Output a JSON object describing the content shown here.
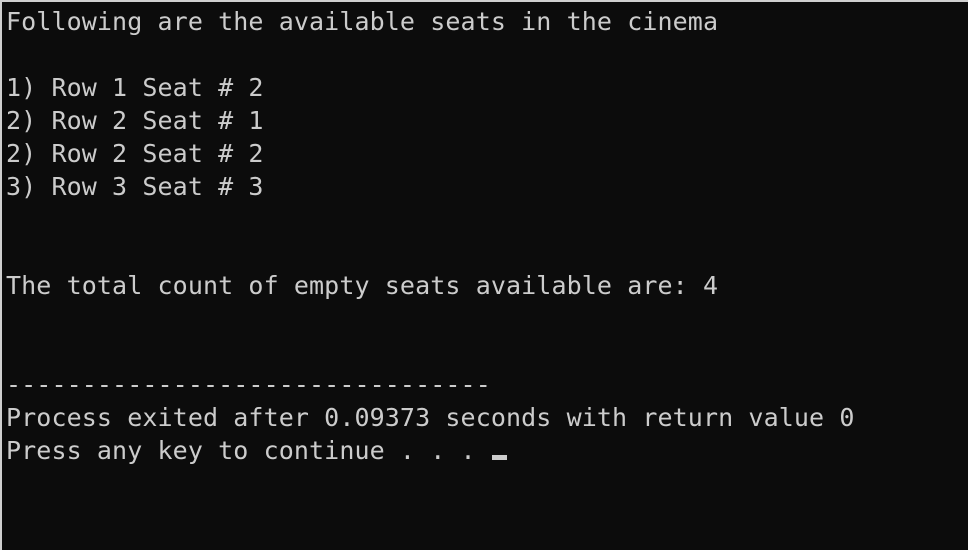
{
  "console": {
    "heading": "Following are the available seats in the cinema",
    "seats": [
      "1) Row 1 Seat # 2",
      "2) Row 2 Seat # 1",
      "2) Row 2 Seat # 2",
      "3) Row 3 Seat # 3"
    ],
    "total_line": "The total count of empty seats available are: 4",
    "separator": "--------------------------------",
    "process_line": "Process exited after 0.09373 seconds with return value 0",
    "prompt_line": "Press any key to continue . . . "
  },
  "colors": {
    "background": "#0c0c0c",
    "text": "#cccccc"
  }
}
